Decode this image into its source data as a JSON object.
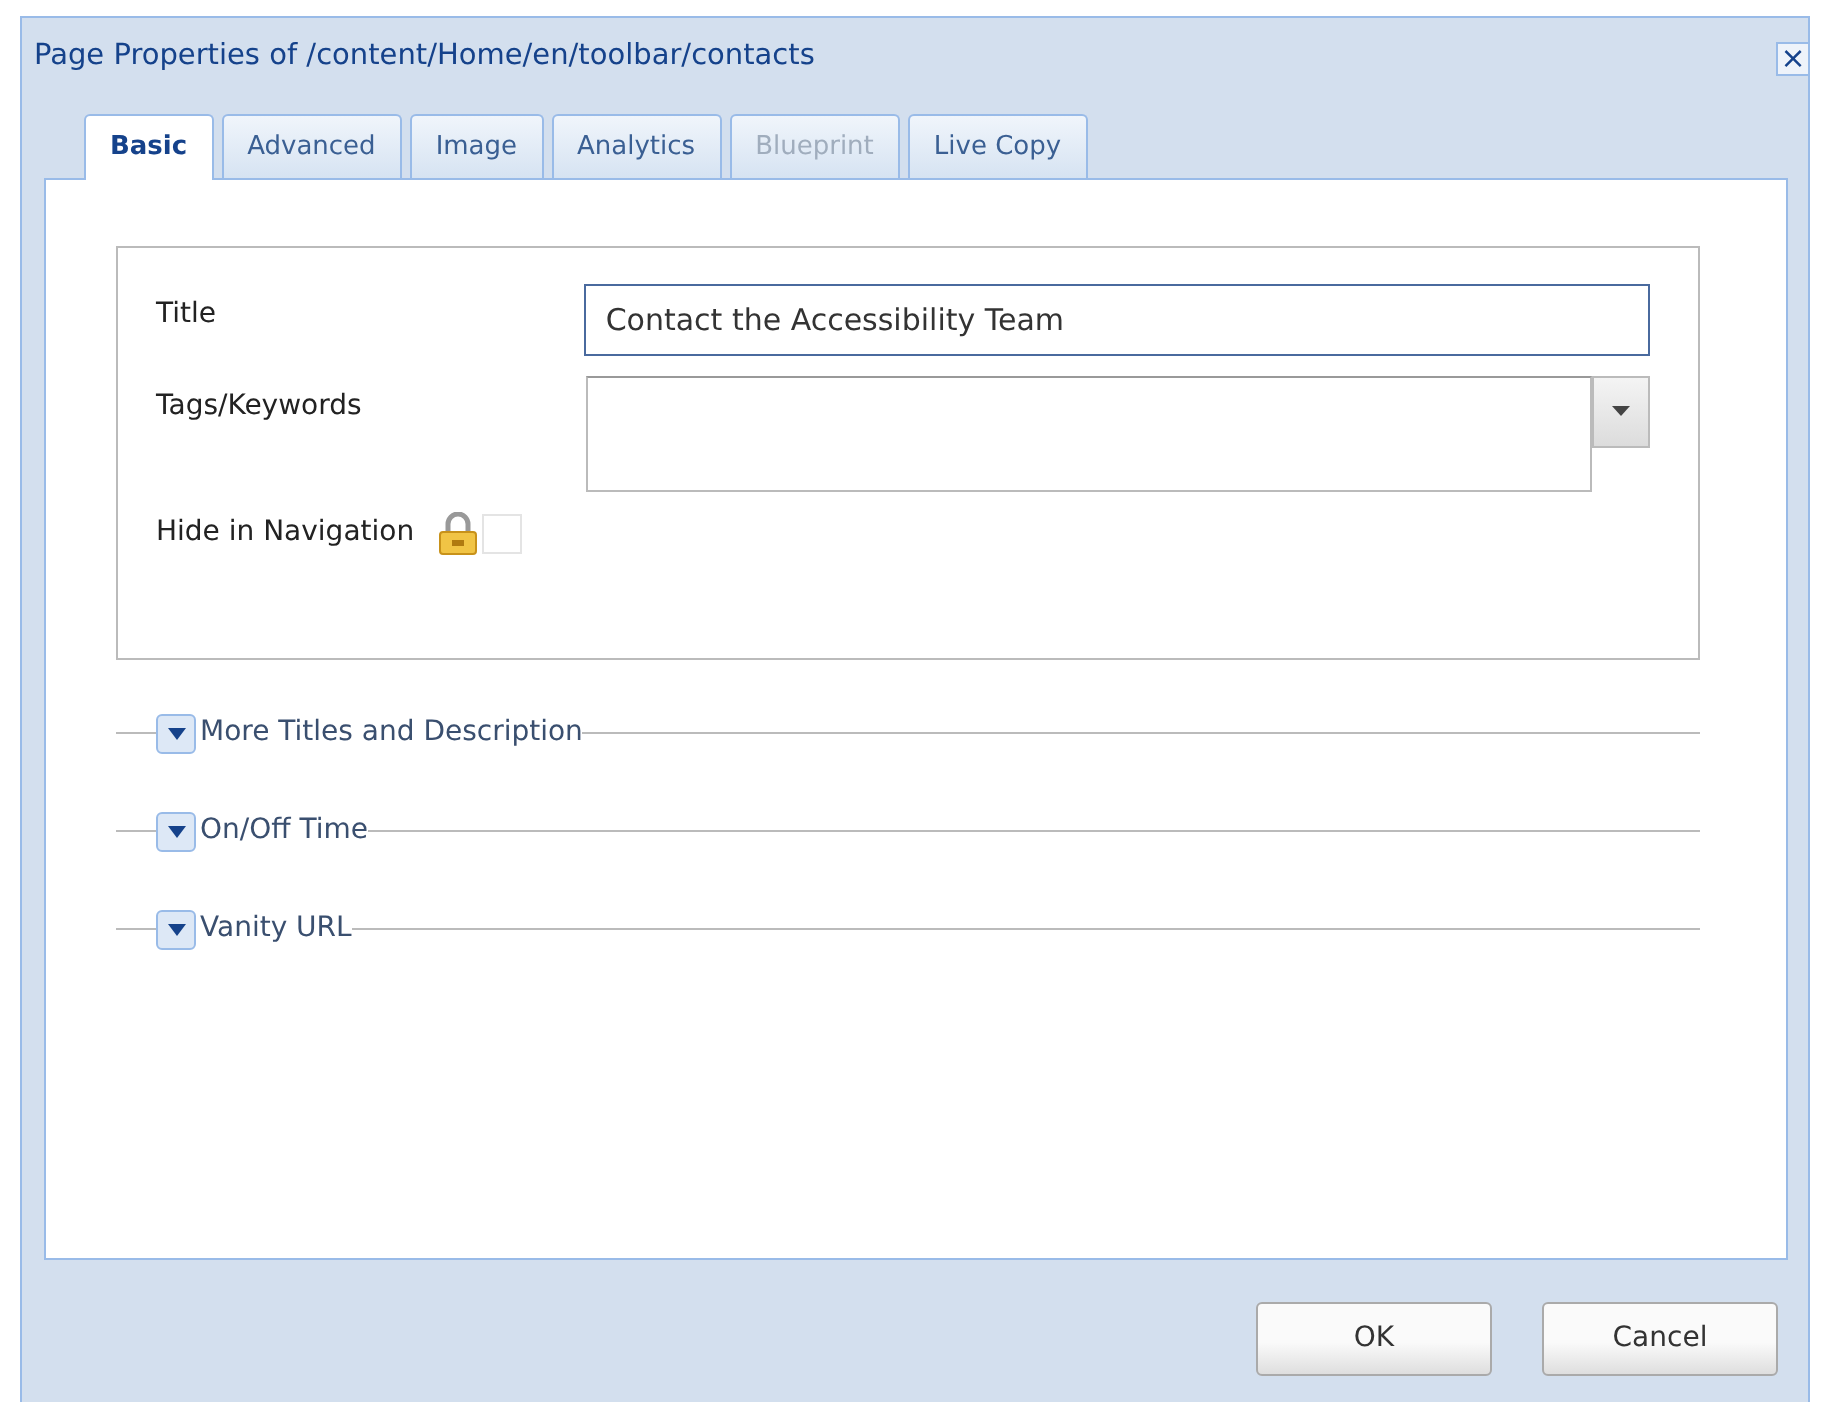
{
  "window": {
    "title": "Page Properties of /content/Home/en/toolbar/contacts",
    "close": "×"
  },
  "tabs": [
    {
      "label": "Basic",
      "selected": true,
      "disabled": false
    },
    {
      "label": "Advanced",
      "selected": false,
      "disabled": false
    },
    {
      "label": "Image",
      "selected": false,
      "disabled": false
    },
    {
      "label": "Analytics",
      "selected": false,
      "disabled": false
    },
    {
      "label": "Blueprint",
      "selected": false,
      "disabled": true
    },
    {
      "label": "Live Copy",
      "selected": false,
      "disabled": false
    }
  ],
  "fields": [
    {
      "kind": "text",
      "label": "Title",
      "value": "Contact the Accessibility Team"
    },
    {
      "kind": "tags",
      "label": "Tags/Keywords"
    },
    {
      "kind": "checkbox",
      "label": "Hide in Navigation",
      "locked": true,
      "checked": false
    }
  ],
  "sections": [
    {
      "label": "More Titles and Description",
      "expanded": false
    },
    {
      "label": "On/Off Time",
      "expanded": false
    },
    {
      "label": "Vanity URL",
      "expanded": false
    }
  ],
  "buttons": [
    "OK",
    "Cancel"
  ]
}
